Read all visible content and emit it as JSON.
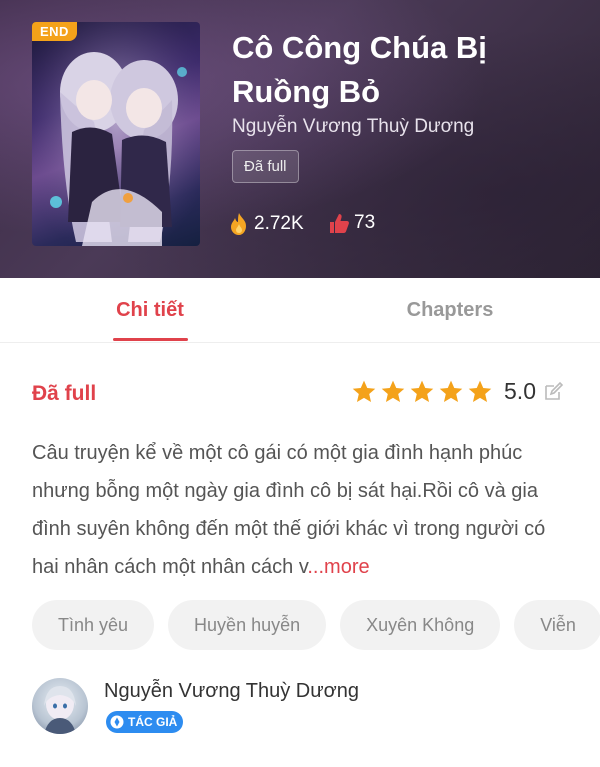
{
  "book": {
    "title": "Cô Công Chúa Bị Ruồng Bỏ",
    "author": "Nguyễn Vương Thuỳ Dương",
    "status_chip": "Đã full",
    "end_badge": "END",
    "views": "2.72K",
    "likes": "73"
  },
  "tabs": [
    {
      "label": "Chi tiết",
      "active": true
    },
    {
      "label": "Chapters",
      "active": false
    }
  ],
  "detail": {
    "status": "Đã full",
    "rating_value": "5.0",
    "rating_stars": 5,
    "description": "Câu truyện kể về một cô gái có một gia đình hạnh phúc nhưng bỗng một ngày gia đình cô bị sát hại.Rồi cô và gia đình suyên không đến một thế giới khác vì trong người có hai nhân cách một nhân cách v",
    "more_label": "...more",
    "tags": [
      "Tình yêu",
      "Huyền huyễn",
      "Xuyên Không",
      "Viễn"
    ]
  },
  "author_section": {
    "name": "Nguyễn Vương Thuỳ Dương",
    "badge": "TÁC GIẢ"
  },
  "colors": {
    "accent": "#e0424b",
    "badge_blue": "#2d8cf0",
    "end_badge": "#f4a21a",
    "star": "#f4a21a"
  },
  "icons": [
    "fire-icon",
    "like-icon",
    "star-icon",
    "edit-icon",
    "author-badge-icon"
  ]
}
